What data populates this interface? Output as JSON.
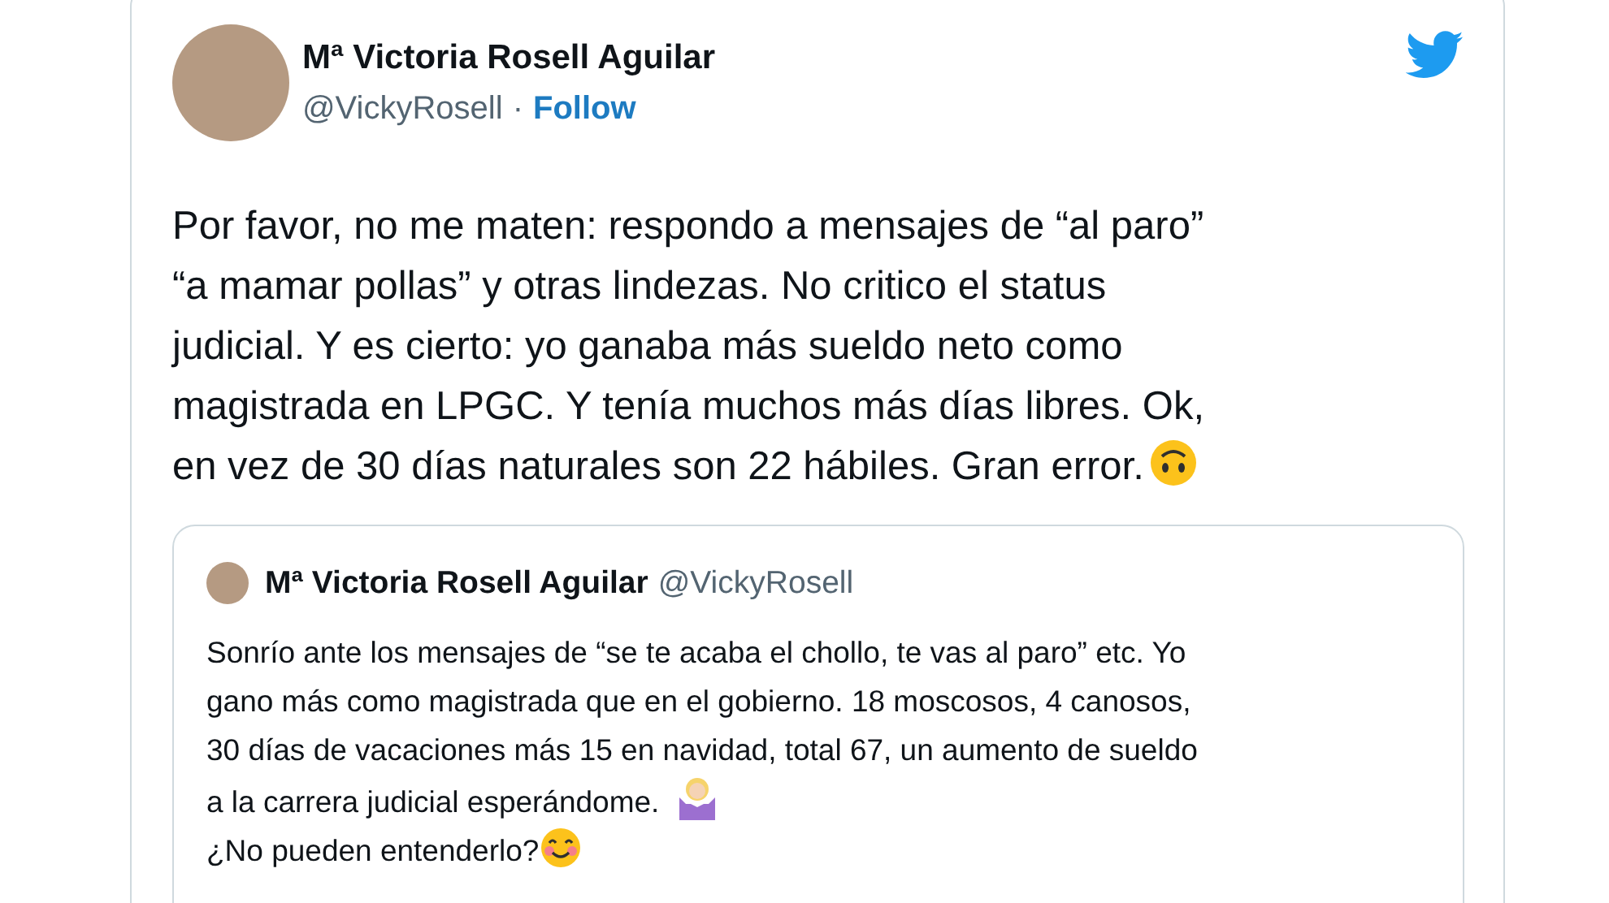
{
  "author": {
    "name": "Mª Victoria Rosell Aguilar",
    "handle": "@VickyRosell",
    "separator": "·",
    "follow": "Follow"
  },
  "text_lines": [
    "Por favor, no me maten: respondo a mensajes de “al paro”",
    "“a mamar pollas” y otras lindezas. No critico el status",
    "judicial. Y es cierto: yo ganaba más sueldo neto como",
    "magistrada en LPGC. Y tenía muchos más días libres. Ok,",
    "en vez de 30 días naturales son 22 hábiles. Gran error."
  ],
  "quoted": {
    "name": "Mª Victoria Rosell Aguilar",
    "handle": "@VickyRosell",
    "text_lines": [
      "Sonrío ante los mensajes de “se te acaba el chollo, te vas al paro” etc. Yo",
      "gano más como magistrada que en el gobierno. 18 moscosos, 4 canosos,",
      "30 días de vacaciones más 15 en navidad, total 67, un aumento de sueldo",
      "a la carrera judicial esperándome.",
      "¿No pueden entenderlo?"
    ]
  }
}
